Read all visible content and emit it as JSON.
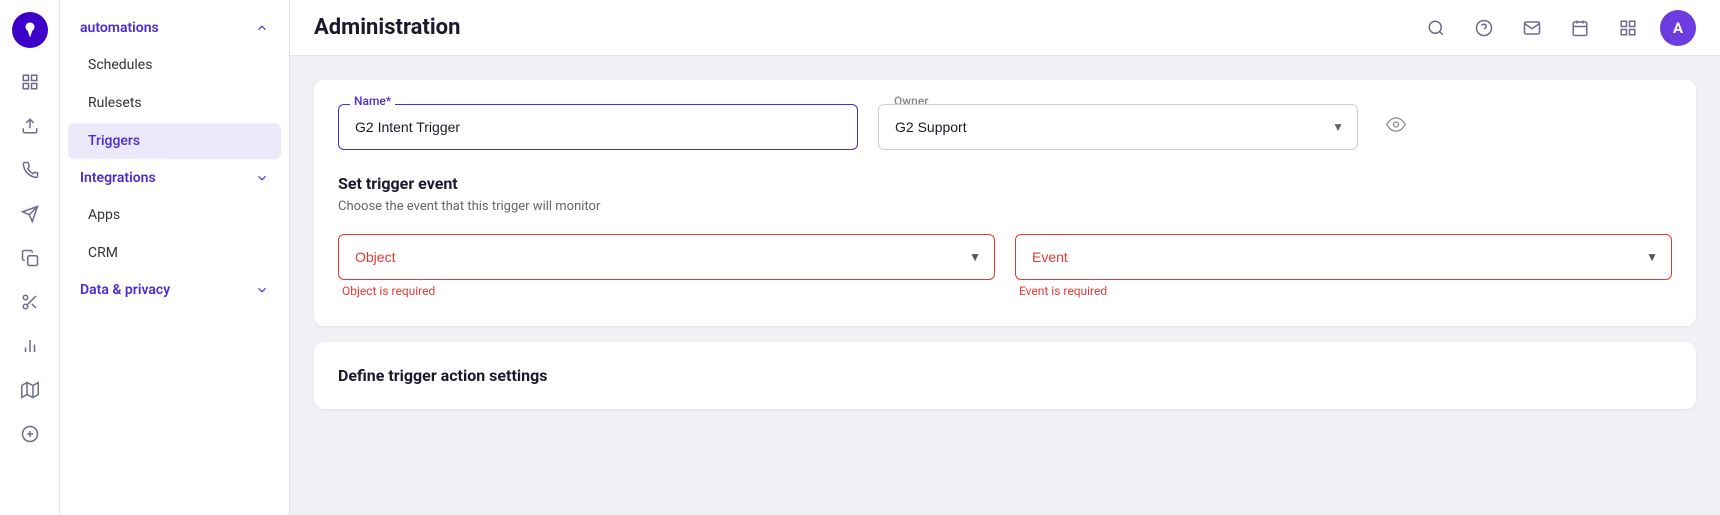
{
  "app": {
    "title": "Administration"
  },
  "header": {
    "icons": [
      "search",
      "help",
      "mail",
      "calendar",
      "grid"
    ],
    "avatar_initials": "A"
  },
  "sidebar_icons": [
    {
      "name": "location-icon",
      "symbol": "📍",
      "active": true
    },
    {
      "name": "grid-icon",
      "symbol": "⊞"
    },
    {
      "name": "upload-icon",
      "symbol": "↑"
    },
    {
      "name": "phone-icon",
      "symbol": "📞"
    },
    {
      "name": "send-icon",
      "symbol": "✉"
    },
    {
      "name": "copy-icon",
      "symbol": "⧉"
    },
    {
      "name": "scissors-icon",
      "symbol": "✂"
    },
    {
      "name": "chart-icon",
      "symbol": "📊"
    },
    {
      "name": "map-icon",
      "symbol": "🗺"
    },
    {
      "name": "plus-circle-icon",
      "symbol": "⊕"
    }
  ],
  "sidebar": {
    "automations_label": "automations",
    "schedules_label": "Schedules",
    "rulesets_label": "Rulesets",
    "triggers_label": "Triggers",
    "integrations_label": "Integrations",
    "apps_label": "Apps",
    "crm_label": "CRM",
    "data_privacy_label": "Data & privacy"
  },
  "form": {
    "name_label": "Name*",
    "name_value": "G2 Intent Trigger",
    "owner_label": "Owner",
    "owner_value": "G2 Support"
  },
  "trigger_event": {
    "title": "Set trigger event",
    "description": "Choose the event that this trigger will monitor",
    "object_label": "Object",
    "object_error": "Object is required",
    "event_label": "Event",
    "event_error": "Event is required"
  },
  "define_section": {
    "title": "Define trigger action settings"
  },
  "colors": {
    "primary": "#4c2bd6",
    "error": "#e53935",
    "active_nav_bg": "#ece9fb"
  }
}
